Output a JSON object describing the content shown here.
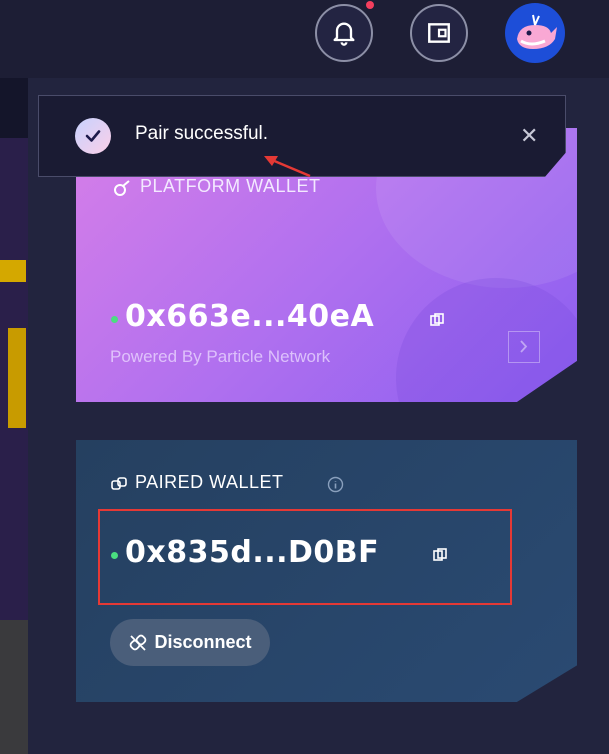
{
  "toast": {
    "message": "Pair successful."
  },
  "platform_wallet": {
    "label": "PLATFORM WALLET",
    "address": "0x663e...40eA",
    "powered_by": "Powered By Particle Network"
  },
  "paired_wallet": {
    "label": "PAIRED WALLET",
    "address": "0x835d...D0BF",
    "disconnect_label": "Disconnect"
  },
  "icons": {
    "bell": "bell-icon",
    "wallet": "wallet-icon",
    "avatar": "whale-avatar",
    "check": "check-icon",
    "close": "close-icon",
    "copy": "copy-icon",
    "info": "info-icon",
    "link": "link-icon",
    "unlink": "unlink-icon",
    "chevron": "chevron-right-icon"
  },
  "colors": {
    "status_online": "#4ade80",
    "notification_dot": "#f43f5e",
    "highlight_box": "#e53935"
  }
}
